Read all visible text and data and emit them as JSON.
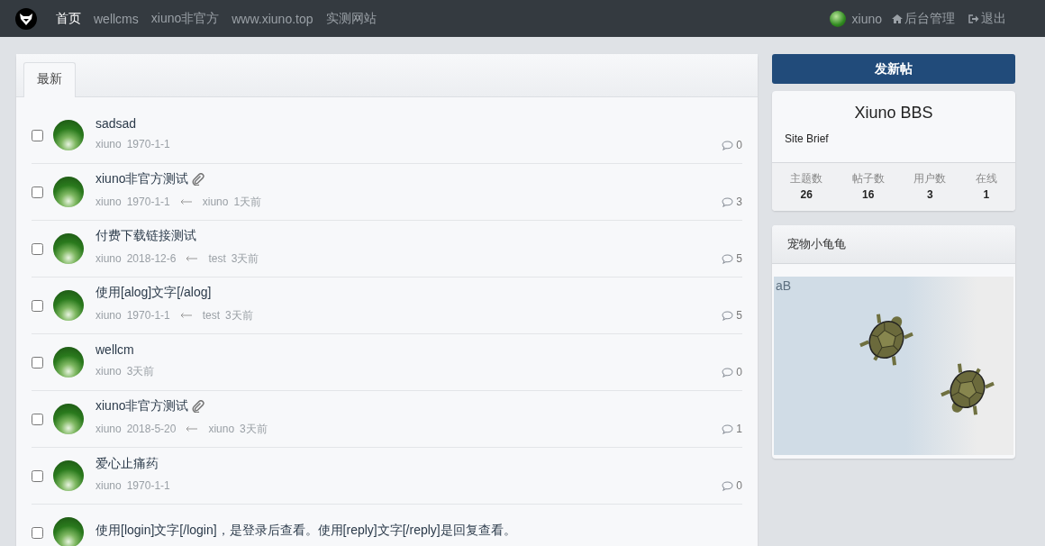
{
  "nav": {
    "links": [
      {
        "label": "首页",
        "selected": true
      },
      {
        "label": "wellcms",
        "selected": false
      },
      {
        "label": "xiuno非官方",
        "selected": false
      },
      {
        "label": "www.xiuno.top",
        "selected": false
      },
      {
        "label": "实测网站",
        "selected": false
      }
    ],
    "user": "xiuno",
    "admin": "后台管理",
    "logout": "退出"
  },
  "tabs": [
    {
      "label": "最新",
      "selected": true
    }
  ],
  "threads": [
    {
      "title": "sadsad",
      "attachment": false,
      "author": "xiuno",
      "date": "1970-1-1",
      "replies": "0",
      "checked": false
    },
    {
      "title": "xiuno非官方测试",
      "attachment": true,
      "author": "xiuno",
      "date": "1970-1-1",
      "last_user": "xiuno",
      "last_time": "1天前",
      "replies": "3",
      "checked": false
    },
    {
      "title": "付费下载链接测试",
      "attachment": false,
      "author": "xiuno",
      "date": "2018-12-6",
      "last_user": "test",
      "last_time": "3天前",
      "replies": "5",
      "checked": false
    },
    {
      "title": "使用[alog]文字[/alog]",
      "attachment": false,
      "author": "xiuno",
      "date": "1970-1-1",
      "last_user": "test",
      "last_time": "3天前",
      "replies": "5",
      "checked": false
    },
    {
      "title": "wellcm",
      "attachment": false,
      "author": "xiuno",
      "date": "3天前",
      "replies": "0",
      "checked": false
    },
    {
      "title": "xiuno非官方测试",
      "attachment": true,
      "author": "xiuno",
      "date": "2018-5-20",
      "last_user": "xiuno",
      "last_time": "3天前",
      "replies": "1",
      "checked": false
    },
    {
      "title": "爱心止痛药",
      "attachment": false,
      "author": "xiuno",
      "date": "1970-1-1",
      "replies": "0",
      "checked": false
    },
    {
      "title": "使用[login]文字[/login]，是登录后查看。使用[reply]文字[/reply]是回复查看。",
      "attachment": false,
      "checked": false
    }
  ],
  "new_thread_button": "发新帖",
  "site": {
    "name": "Xiuno BBS",
    "brief": "Site Brief",
    "stats": [
      {
        "label": "主题数",
        "value": "26"
      },
      {
        "label": "帖子数",
        "value": "16"
      },
      {
        "label": "用户数",
        "value": "3"
      },
      {
        "label": "在线",
        "value": "1"
      }
    ]
  },
  "widget": {
    "title": "宠物小龟龟",
    "badge": "aB"
  }
}
